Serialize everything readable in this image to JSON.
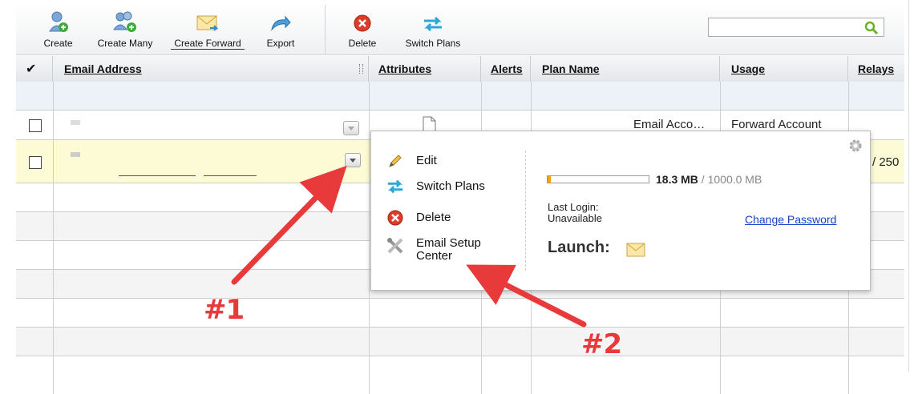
{
  "toolbar": {
    "create": "Create",
    "create_many": "Create Many",
    "create_forward": "Create Forward",
    "export": "Export",
    "delete": "Delete",
    "switch_plans": "Switch Plans",
    "search_value": ""
  },
  "table": {
    "check_header": "✔",
    "columns": {
      "email": "Email Address",
      "attributes": "Attributes",
      "alerts": "Alerts",
      "plan": "Plan Name",
      "usage": "Usage",
      "relays": "Relays"
    },
    "rows": [
      {
        "plan": "Email Acco…",
        "usage": "Forward Account",
        "relays": ""
      },
      {
        "plan": "",
        "usage": "",
        "relays": "/ 250"
      }
    ]
  },
  "popup": {
    "menu": {
      "edit": "Edit",
      "switch_plans": "Switch Plans",
      "delete": "Delete",
      "email_setup_line1": "Email Setup",
      "email_setup_line2": "Center"
    },
    "quota_used": "18.3 MB",
    "quota_total": " / 1000.0 MB",
    "quota_fraction": 0.018,
    "last_login_label": "Last Login:",
    "last_login_value": "Unavailable",
    "change_password": "Change Password",
    "launch": "Launch:"
  },
  "annotations": {
    "label1": "#1",
    "label2": "#2"
  },
  "colors": {
    "accent_link": "#1a3fc7",
    "row_highlight": "#fdfbd6",
    "annotation_red": "#e83a3a"
  }
}
